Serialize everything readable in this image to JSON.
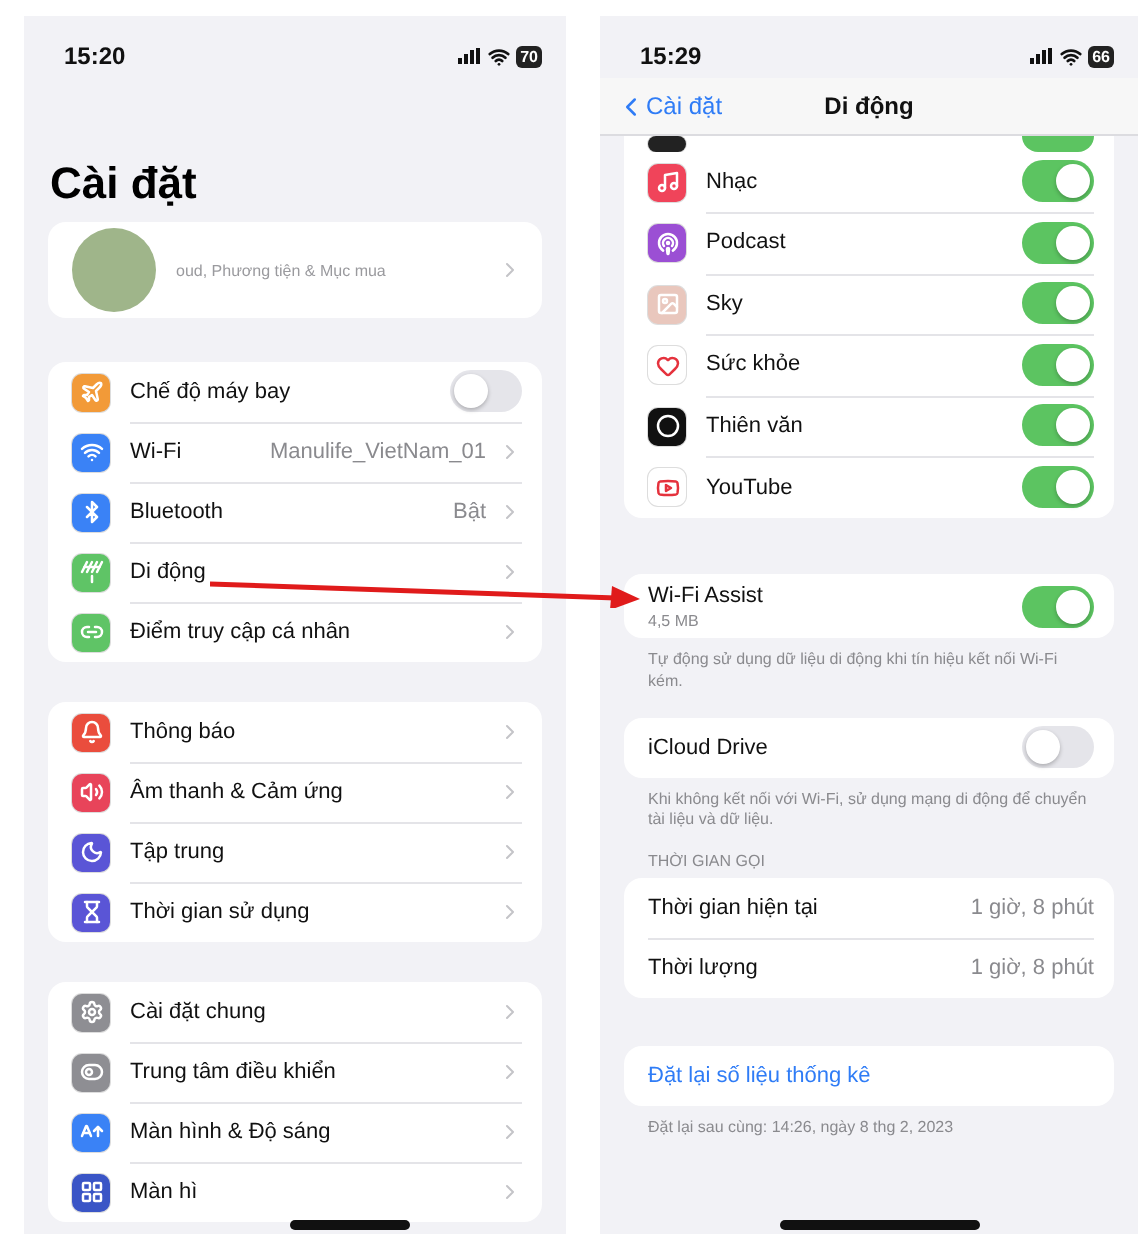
{
  "left": {
    "status_bar": {
      "time": "15:20",
      "battery": "70"
    },
    "title": "Cài đặt",
    "profile": {
      "subtitle": "oud, Phương tiện & Mục mua"
    },
    "groups": [
      [
        {
          "label": "Chế độ máy bay",
          "kind": "toggle",
          "on": false,
          "color": "#f29a38"
        },
        {
          "label": "Wi-Fi",
          "value": "Manulife_VietNam_01",
          "kind": "link",
          "color": "#3a82f6"
        },
        {
          "label": "Bluetooth",
          "value": "Bật",
          "kind": "link",
          "color": "#3a82f6"
        },
        {
          "label": "Di động",
          "kind": "link",
          "color": "#5fc466"
        },
        {
          "label": "Điểm truy cập cá nhân",
          "kind": "link",
          "color": "#5fc466"
        }
      ],
      [
        {
          "label": "Thông báo",
          "kind": "link",
          "color": "#ea4d3d"
        },
        {
          "label": "Âm thanh & Cảm ứng",
          "kind": "link",
          "color": "#e8445a"
        },
        {
          "label": "Tập trung",
          "kind": "link",
          "color": "#5a55d6"
        },
        {
          "label": "Thời gian sử dụng",
          "kind": "link",
          "color": "#5a55d6"
        }
      ],
      [
        {
          "label": "Cài đặt chung",
          "kind": "link",
          "color": "#8e8e93"
        },
        {
          "label": "Trung tâm điều khiển",
          "kind": "link",
          "color": "#8e8e93"
        },
        {
          "label": "Màn hình & Độ sáng",
          "kind": "link",
          "color": "#3a82f6"
        },
        {
          "label": "Màn hì",
          "kind": "link",
          "color": "#3a55c6"
        }
      ]
    ]
  },
  "right": {
    "status_bar": {
      "time": "15:29",
      "battery": "66"
    },
    "nav": {
      "back": "Cài đặt",
      "title": "Di động"
    },
    "apps": [
      {
        "kind": "partial",
        "on": true,
        "color": "#222222"
      },
      {
        "kind": "app",
        "label": "Nhạc",
        "on": true,
        "color": "#f0445a"
      },
      {
        "kind": "app",
        "label": "Podcast",
        "on": true,
        "color": "#9b4fd4"
      },
      {
        "kind": "app",
        "label": "Sky",
        "on": true,
        "color": "#e9c7bd"
      },
      {
        "kind": "app",
        "label": "Sức khỏe",
        "on": true,
        "color": "#ffffff"
      },
      {
        "kind": "app",
        "label": "Thiên văn",
        "on": true,
        "color": "#111111"
      },
      {
        "kind": "app",
        "label": "YouTube",
        "on": true,
        "color": "#ffffff"
      }
    ],
    "wifi_assist": {
      "label": "Wi-Fi Assist",
      "detail": "4,5 MB",
      "on": true,
      "footer": "Tự động sử dụng dữ liệu di động khi tín hiệu kết nối Wi-Fi kém."
    },
    "icloud": {
      "label": "iCloud Drive",
      "on": false,
      "footer": "Khi không kết nối với Wi-Fi, sử dụng mạng di động để chuyển tài liệu và dữ liệu."
    },
    "call_time": {
      "header": "THỜI GIAN GỌI",
      "rows": [
        {
          "label": "Thời gian hiện tại",
          "value": "1 giờ, 8 phút"
        },
        {
          "label": "Thời lượng",
          "value": "1 giờ, 8 phút"
        }
      ]
    },
    "reset": {
      "link": "Đặt lại số liệu thống kê",
      "footer": "Đặt lại sau cùng: 14:26, ngày 8 thg 2, 2023"
    }
  }
}
